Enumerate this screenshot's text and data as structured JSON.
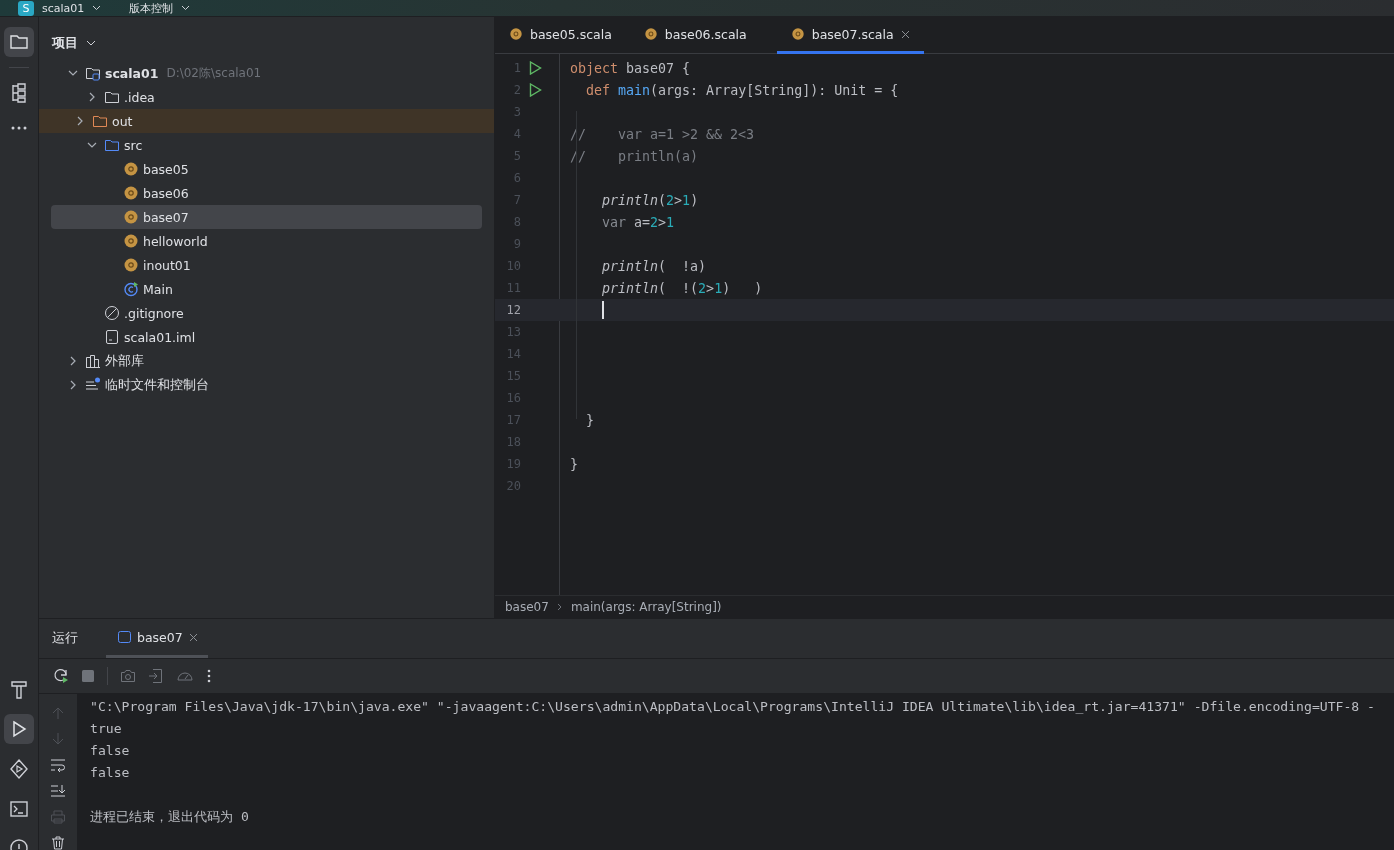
{
  "title_bar": {
    "badge_letter": "S",
    "project": "scala01",
    "vcs": "版本控制"
  },
  "project_panel": {
    "title": "项目"
  },
  "tree": [
    {
      "kind": "project",
      "label": "scala01",
      "path": "D:\\02陈\\scala01",
      "expanded": true,
      "selected": false,
      "children": [
        {
          "kind": "folder",
          "label": ".idea",
          "expanded": false,
          "selected": false
        },
        {
          "kind": "excluded-folder",
          "label": "out",
          "expanded": false,
          "selected": false
        },
        {
          "kind": "source-folder",
          "label": "src",
          "expanded": true,
          "selected": false,
          "children": [
            {
              "kind": "scala-object",
              "label": "base05",
              "selected": false
            },
            {
              "kind": "scala-object",
              "label": "base06",
              "selected": false
            },
            {
              "kind": "scala-object",
              "label": "base07",
              "selected": true
            },
            {
              "kind": "scala-object",
              "label": "helloworld",
              "selected": false
            },
            {
              "kind": "scala-object",
              "label": "inout01",
              "selected": false
            },
            {
              "kind": "main-class",
              "label": "Main",
              "selected": false
            }
          ]
        },
        {
          "kind": "ignore-file",
          "label": ".gitignore",
          "selected": false
        },
        {
          "kind": "module-file",
          "label": "scala01.iml",
          "selected": false
        }
      ]
    },
    {
      "kind": "library",
      "label": "外部库",
      "expanded": false,
      "selected": false
    },
    {
      "kind": "scratches",
      "label": "临时文件和控制台",
      "expanded": false,
      "selected": false
    }
  ],
  "editor_tabs": [
    {
      "label": "base05.scala",
      "selected": false
    },
    {
      "label": "base06.scala",
      "selected": false
    },
    {
      "label": "base07.scala",
      "selected": true
    }
  ],
  "code_lines": [
    {
      "number": "1",
      "run": true,
      "current": false,
      "tokens": [
        {
          "kind": "keyword",
          "text": "object"
        },
        {
          "kind": "plain",
          "text": " base07 {"
        }
      ]
    },
    {
      "number": "2",
      "run": true,
      "current": false,
      "tokens": [
        {
          "kind": "keyword",
          "text": "  def "
        },
        {
          "kind": "function",
          "text": "main"
        },
        {
          "kind": "plain",
          "text": "(args: Array[String]): Unit = {"
        }
      ]
    },
    {
      "number": "3",
      "run": false,
      "current": false
    },
    {
      "number": "4",
      "run": false,
      "current": false,
      "tokens": [
        {
          "kind": "comment",
          "text": "//    var a=1 >2 && 2<3"
        }
      ]
    },
    {
      "number": "5",
      "run": false,
      "current": false,
      "tokens": [
        {
          "kind": "comment",
          "text": "//    println(a)"
        }
      ]
    },
    {
      "number": "6",
      "run": false,
      "current": false
    },
    {
      "number": "7",
      "run": false,
      "current": false,
      "tokens": [
        {
          "kind": "call",
          "text": "    println"
        },
        {
          "kind": "plain",
          "text": "("
        },
        {
          "kind": "number",
          "text": "2"
        },
        {
          "kind": "plain",
          "text": ">"
        },
        {
          "kind": "number",
          "text": "1"
        },
        {
          "kind": "plain",
          "text": ")"
        }
      ]
    },
    {
      "number": "8",
      "run": false,
      "current": false,
      "tokens": [
        {
          "kind": "dim",
          "text": "    var"
        },
        {
          "kind": "plain",
          "text": " a="
        },
        {
          "kind": "number",
          "text": "2"
        },
        {
          "kind": "plain",
          "text": ">"
        },
        {
          "kind": "number",
          "text": "1"
        }
      ]
    },
    {
      "number": "9",
      "run": false,
      "current": false
    },
    {
      "number": "10",
      "run": false,
      "current": false,
      "tokens": [
        {
          "kind": "call",
          "text": "    println"
        },
        {
          "kind": "plain",
          "text": "(  !a)"
        }
      ]
    },
    {
      "number": "11",
      "run": false,
      "current": false,
      "tokens": [
        {
          "kind": "call",
          "text": "    println"
        },
        {
          "kind": "plain",
          "text": "(  !("
        },
        {
          "kind": "number",
          "text": "2"
        },
        {
          "kind": "plain",
          "text": ">"
        },
        {
          "kind": "number",
          "text": "1"
        },
        {
          "kind": "plain",
          "text": ")   )"
        }
      ]
    },
    {
      "number": "12",
      "run": false,
      "current": true
    },
    {
      "number": "13",
      "run": false,
      "current": false
    },
    {
      "number": "14",
      "run": false,
      "current": false
    },
    {
      "number": "15",
      "run": false,
      "current": false
    },
    {
      "number": "16",
      "run": false,
      "current": false
    },
    {
      "number": "17",
      "run": false,
      "current": false,
      "tokens": [
        {
          "kind": "plain",
          "text": "  }"
        }
      ]
    },
    {
      "number": "18",
      "run": false,
      "current": false
    },
    {
      "number": "19",
      "run": false,
      "current": false,
      "tokens": [
        {
          "kind": "plain",
          "text": "}"
        }
      ]
    },
    {
      "number": "20",
      "run": false,
      "current": false
    }
  ],
  "breadcrumbs": [
    "base07",
    "main(args: Array[String])"
  ],
  "run_panel": {
    "title": "运行",
    "tabs": [
      {
        "label": "base07",
        "selected": true
      }
    ]
  },
  "console_lines": [
    "\"C:\\Program Files\\Java\\jdk-17\\bin\\java.exe\" \"-javaagent:C:\\Users\\admin\\AppData\\Local\\Programs\\IntelliJ IDEA Ultimate\\lib\\idea_rt.jar=41371\" -Dfile.encoding=UTF-8 -",
    "true",
    "false",
    "false"
  ],
  "exit_message": "进程已结束，退出代码为 0"
}
